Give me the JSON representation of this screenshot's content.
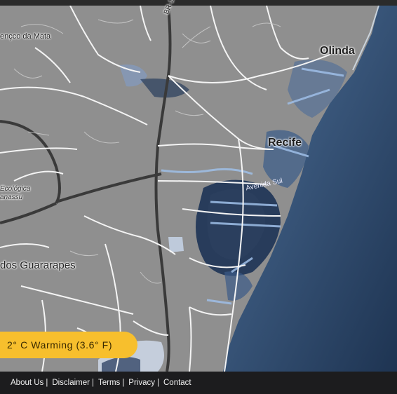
{
  "map": {
    "labels": {
      "olinda": "Olinda",
      "recife": "Recife",
      "lourenco": "ençco da Mata",
      "eco": "Ecológica",
      "nassu": "anassu",
      "guararapes": "dos Guararapes",
      "br101": "BR-101",
      "avenida": "Avenida Sul"
    },
    "colors": {
      "land": "#8f8f8f",
      "ocean": "#2f4a6e",
      "roads": "#ffffff",
      "flood_deep": "#1f3557",
      "flood_light": "#9fbfe8"
    }
  },
  "scenario": {
    "label": "2° C Warming (3.6° F)",
    "color": "#f7bf2d"
  },
  "footer": {
    "links": [
      "About Us",
      "Disclaimer",
      "Terms",
      "Privacy",
      "Contact"
    ]
  }
}
